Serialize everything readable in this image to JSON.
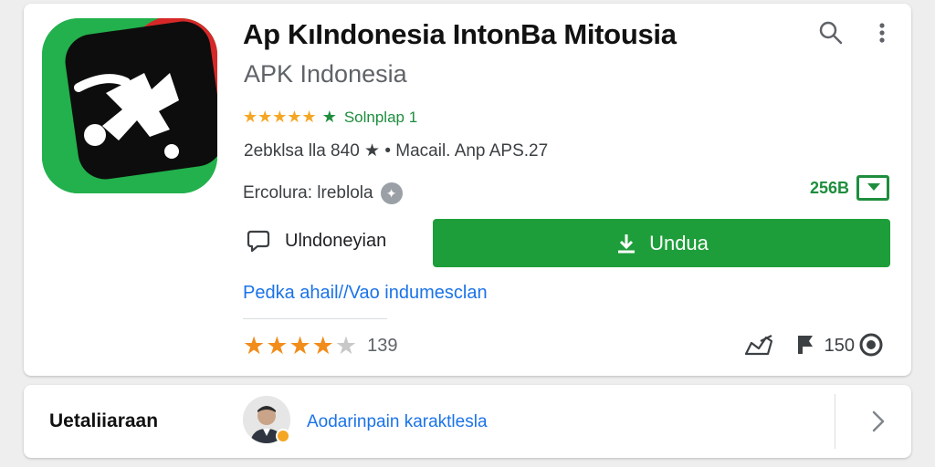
{
  "app": {
    "title": "Ap KıIndonesia IntonBa Mitousia",
    "subtitle": "APK Indonesia",
    "rating_stars": "★★★★★",
    "rating_green_star": "★",
    "rating_text": "Solnplap 1",
    "meta": "2ebklsa lla 840 ★ • Macail. Anp APS.27",
    "category": "Ercolura: lreblola",
    "size": "256B",
    "language": "Ulndoneyian",
    "install_label": "Undua",
    "link": "Pedka ahail//Vao indumesclan",
    "review_stars_filled": 4,
    "review_stars_total": 5,
    "review_count": "139",
    "view_count": "150"
  },
  "developer": {
    "label": "Uetaliiaraan",
    "name": "Aodarinpain karaktlesla"
  },
  "colors": {
    "accent_green": "#1e9e3a",
    "link_blue": "#1a73e8",
    "star_orange": "#f28c1b",
    "icon_green": "#22b14c",
    "icon_red": "#d62828"
  },
  "icons": {
    "search": "search-icon",
    "more": "more-vert-icon",
    "install": "download-icon",
    "share": "share-icon",
    "flag": "flag-icon",
    "view": "eye-icon",
    "chevron": "chevron-right-icon"
  }
}
